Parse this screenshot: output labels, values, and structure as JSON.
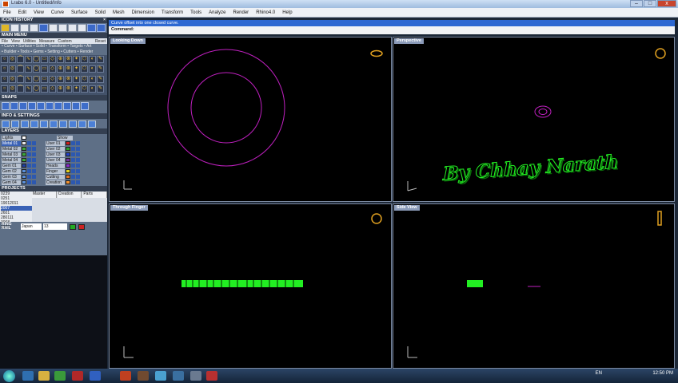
{
  "window": {
    "title": "Lrabo 6.0 - Untitled/Info",
    "minimize": "–",
    "maximize": "□",
    "close": "x"
  },
  "menu": [
    "File",
    "Edit",
    "View",
    "Curve",
    "Surface",
    "Solid",
    "Mesh",
    "Dimension",
    "Transform",
    "Tools",
    "Analyze",
    "Render",
    "Rhino4.0",
    "Help"
  ],
  "left_panel": {
    "icon_history": "ICON HISTORY",
    "main_menu": "MAIN MENU",
    "main_menu_tabs": [
      "File",
      "View",
      "Utilities",
      "Measure",
      "Custom"
    ],
    "main_menu_reset": "Reset",
    "commands_row1": "• Curve • Surface • Solid • Transform • Targets • Art",
    "commands_row2": "• Builder • Tools • Gems • Setting • Cutters • Render",
    "snaps": "SNAPS",
    "info_settings": "INFO & SETTINGS",
    "layers": "LAYERS",
    "layers_lights_label": "Lights",
    "layers_show_label": "Show",
    "layers_left": [
      "Metal 01",
      "Metal 02",
      "Metal 03",
      "Metal 04",
      "Gem 01",
      "Gem 02",
      "Gem 03",
      "Gem 04"
    ],
    "layers_right": [
      "User 01",
      "User 02",
      "User 03",
      "User 04",
      "Heads",
      "Finger",
      "Cutting",
      "Creation"
    ],
    "layer_colors_left": [
      "#e8e8e8",
      "#3aa63a",
      "#3aa63a",
      "#3aa63a",
      "#1f3fa0",
      "#5a8fd8",
      "#5a8fd8",
      "#5a8fd8"
    ],
    "layer_colors_right": [
      "#d01c1c",
      "#2aa02a",
      "#2040d0",
      "#7030a0",
      "#8a2ad0",
      "#e0d020",
      "#e07020",
      "#f09030"
    ],
    "projects": "PROJECTS",
    "projects_list": [
      "0239",
      "0251",
      "19012011",
      "2007",
      "2601",
      "280111",
      "3068",
      "3073"
    ],
    "projects_selected_index": 3,
    "projects_columns": [
      "Master",
      "Creation",
      "Parts"
    ],
    "ring_label": "RING",
    "rail_label": "RAIL",
    "ring_standard": "Japan",
    "ring_size": "13"
  },
  "command": {
    "history": "Curve offset into one closed curve.",
    "prompt": "Command:"
  },
  "viewports": {
    "top_left": "Looking Down",
    "top_right": "Perspective",
    "bottom_left": "Through Finger",
    "bottom_right": "Side View"
  },
  "watermark": "By Chhay Narath",
  "tray": {
    "lang": "EN",
    "time": "12:50 PM"
  },
  "colors": {
    "curve_magenta": "#c020c0",
    "model_green": "#22ee22",
    "ring_icon": "#e0a020"
  }
}
